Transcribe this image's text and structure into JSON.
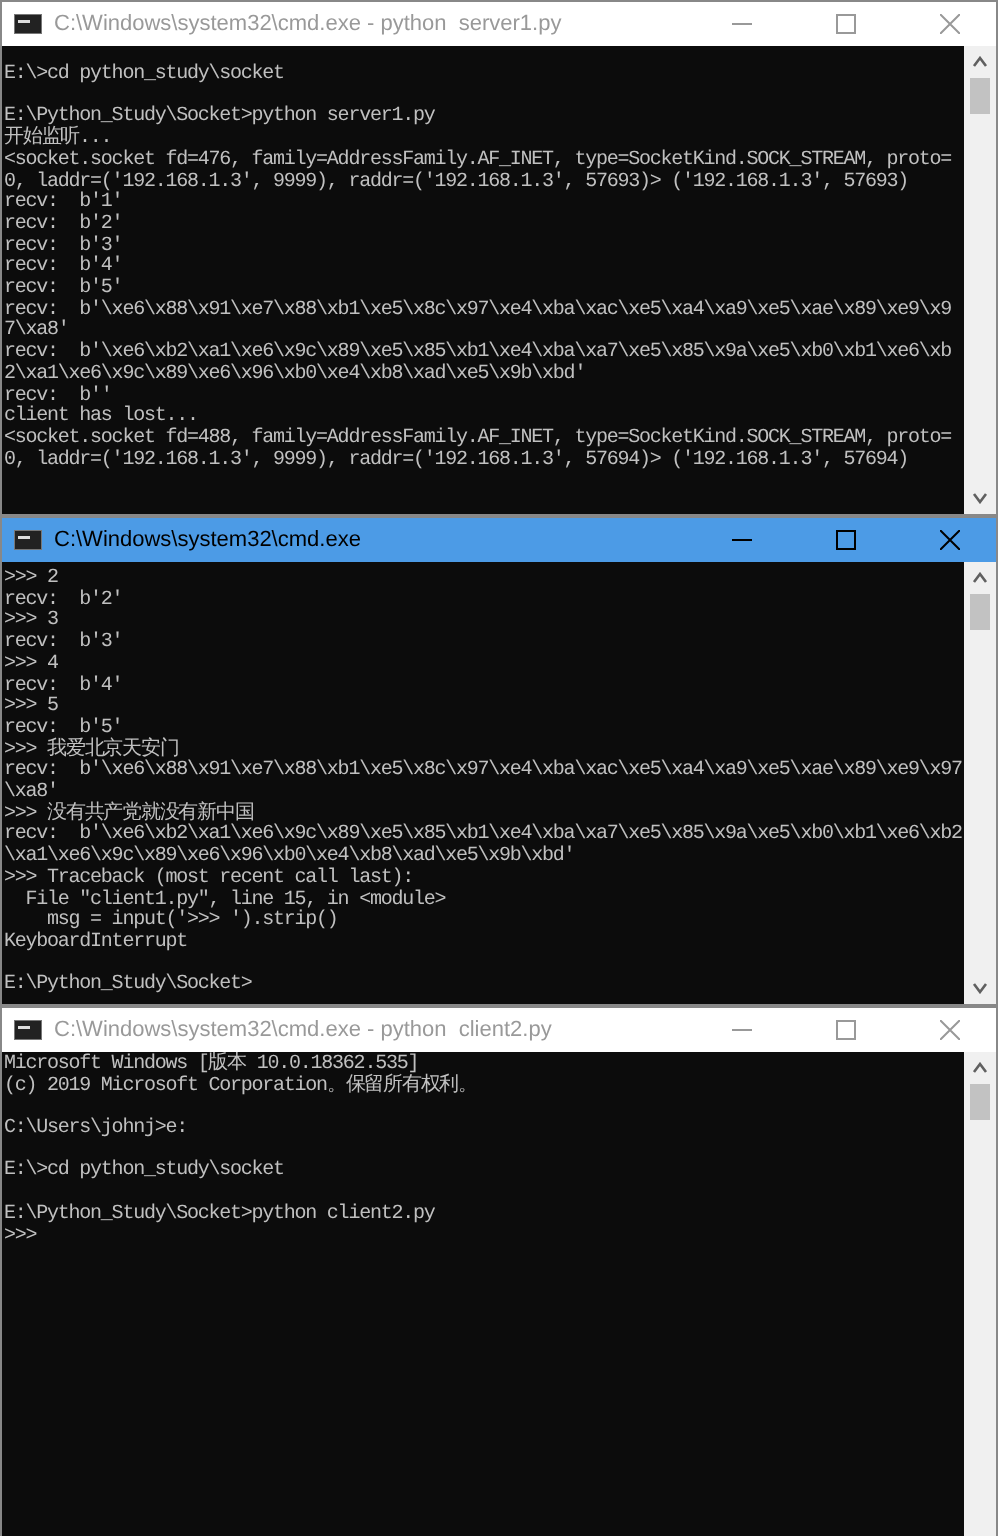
{
  "windows": [
    {
      "title": "C:\\Windows\\system32\\cmd.exe - python  server1.py",
      "active": false,
      "blocks": [
        [
          "E:\\>cd python_study\\socket"
        ],
        [
          "E:\\Python_Study\\Socket>python server1.py",
          "开始监听...",
          "<socket.socket fd=476, family=AddressFamily.AF_INET, type=SocketKind.SOCK_STREAM, proto=",
          "0, laddr=('192.168.1.3', 9999), raddr=('192.168.1.3', 57693)> ('192.168.1.3', 57693)",
          "recv:  b'1'",
          "recv:  b'2'",
          "recv:  b'3'",
          "recv:  b'4'",
          "recv:  b'5'",
          "recv:  b'\\xe6\\x88\\x91\\xe7\\x88\\xb1\\xe5\\x8c\\x97\\xe4\\xba\\xac\\xe5\\xa4\\xa9\\xe5\\xae\\x89\\xe9\\x9",
          "7\\xa8'",
          "recv:  b'\\xe6\\xb2\\xa1\\xe6\\x9c\\x89\\xe5\\x85\\xb1\\xe4\\xba\\xa7\\xe5\\x85\\x9a\\xe5\\xb0\\xb1\\xe6\\xb",
          "2\\xa1\\xe6\\x9c\\x89\\xe6\\x96\\xb0\\xe4\\xb8\\xad\\xe5\\x9b\\xbd'",
          "recv:  b''",
          "client has lost...",
          "<socket.socket fd=488, family=AddressFamily.AF_INET, type=SocketKind.SOCK_STREAM, proto=",
          "0, laddr=('192.168.1.3', 9999), raddr=('192.168.1.3', 57694)> ('192.168.1.3', 57694)"
        ]
      ]
    },
    {
      "title": "C:\\Windows\\system32\\cmd.exe",
      "active": true,
      "blocks": [
        [
          ">>> 2",
          "recv:  b'2'",
          ">>> 3",
          "recv:  b'3'",
          ">>> 4",
          "recv:  b'4'",
          ">>> 5",
          "recv:  b'5'",
          ">>> 我爱北京天安门",
          "recv:  b'\\xe6\\x88\\x91\\xe7\\x88\\xb1\\xe5\\x8c\\x97\\xe4\\xba\\xac\\xe5\\xa4\\xa9\\xe5\\xae\\x89\\xe9\\x97",
          "\\xa8'",
          ">>> 没有共产党就没有新中国",
          "recv:  b'\\xe6\\xb2\\xa1\\xe6\\x9c\\x89\\xe5\\x85\\xb1\\xe4\\xba\\xa7\\xe5\\x85\\x9a\\xe5\\xb0\\xb1\\xe6\\xb2",
          "\\xa1\\xe6\\x9c\\x89\\xe6\\x96\\xb0\\xe4\\xb8\\xad\\xe5\\x9b\\xbd'",
          ">>> Traceback (most recent call last):",
          "  File \"client1.py\", line 15, in <module>",
          "    msg = input('>>> ').strip()",
          "KeyboardInterrupt"
        ],
        [
          "E:\\Python_Study\\Socket>"
        ]
      ]
    },
    {
      "title": "C:\\Windows\\system32\\cmd.exe - python  client2.py",
      "active": false,
      "blocks": [
        [
          "Microsoft Windows [版本 10.0.18362.535]",
          "(c) 2019 Microsoft Corporation。保留所有权利。"
        ],
        [
          "C:\\Users\\johnj>e:"
        ],
        [
          "E:\\>cd python_study\\socket"
        ],
        [
          "E:\\Python_Study\\Socket>python client2.py",
          ">>>"
        ]
      ]
    }
  ]
}
